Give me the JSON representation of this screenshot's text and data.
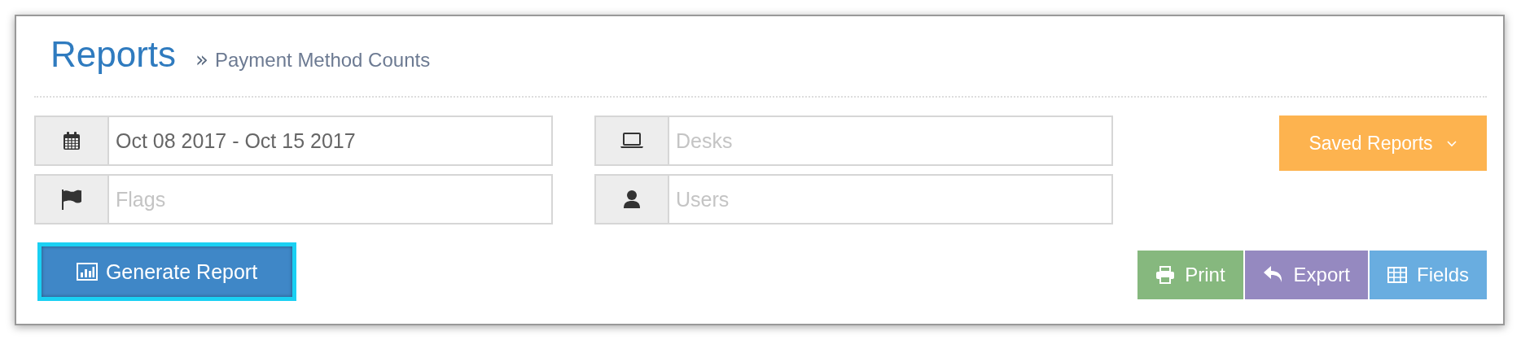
{
  "header": {
    "title": "Reports",
    "breadcrumb_separator": "»",
    "breadcrumb": "Payment Method Counts"
  },
  "filters": [
    {
      "kind": "calendar",
      "value": "Oct 08 2017 - Oct 15 2017"
    },
    {
      "kind": "laptop",
      "placeholder": "Desks"
    },
    {
      "kind": "flag",
      "placeholder": "Flags"
    },
    {
      "kind": "user",
      "placeholder": "Users"
    }
  ],
  "saved_reports": {
    "label": "Saved Reports"
  },
  "generate_button": {
    "label": "Generate Report",
    "focused": true
  },
  "actions": [
    {
      "kind": "print",
      "label": "Print",
      "color": "#86b87e"
    },
    {
      "kind": "export",
      "label": "Export",
      "color": "#9589c0"
    },
    {
      "kind": "fields",
      "label": "Fields",
      "color": "#69ade0"
    }
  ]
}
